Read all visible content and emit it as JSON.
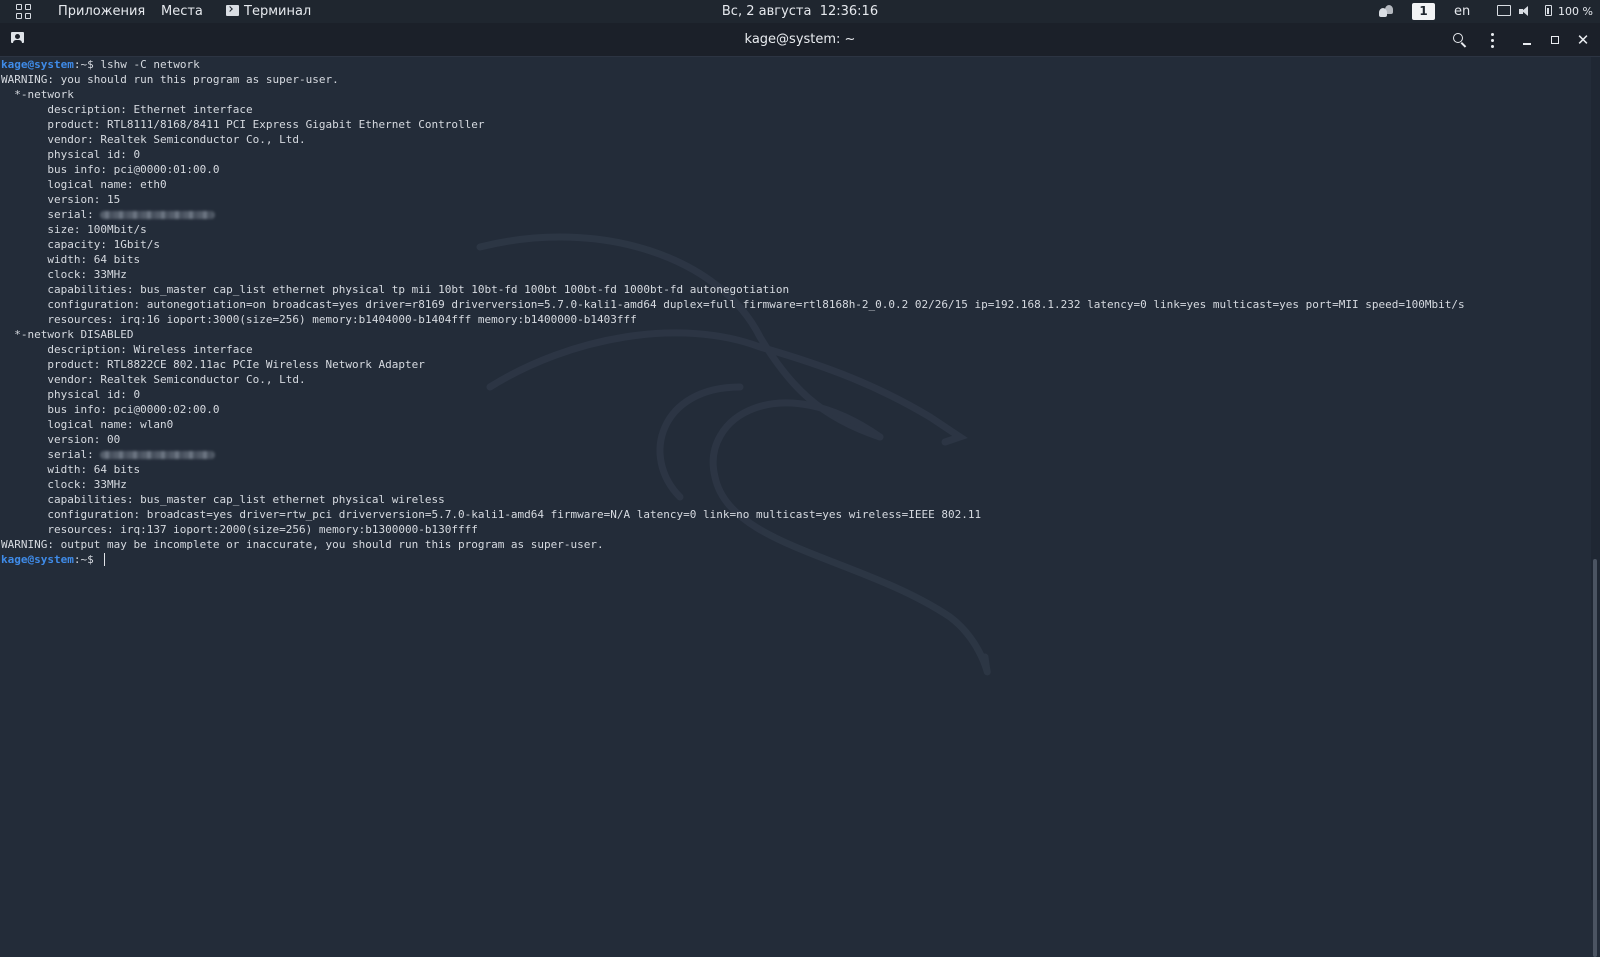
{
  "topbar": {
    "applications_label": "Приложения",
    "places_label": "Места",
    "terminal_label": "Терминал",
    "datetime": "Вс, 2 августа  12:36:16",
    "workspace": "1",
    "keyboard_layout": "en",
    "battery": "100 %"
  },
  "window": {
    "title": "kage@system: ~"
  },
  "terminal": {
    "prompt_user": "kage@system",
    "prompt_suffix": ":~$ ",
    "command": "lshw -C network",
    "lines": [
      "WARNING: you should run this program as super-user.",
      "  *-network",
      "       description: Ethernet interface",
      "       product: RTL8111/8168/8411 PCI Express Gigabit Ethernet Controller",
      "       vendor: Realtek Semiconductor Co., Ltd.",
      "       physical id: 0",
      "       bus info: pci@0000:01:00.0",
      "       logical name: eth0",
      "       version: 15",
      "       serial: ",
      "       size: 100Mbit/s",
      "       capacity: 1Gbit/s",
      "       width: 64 bits",
      "       clock: 33MHz",
      "       capabilities: bus_master cap_list ethernet physical tp mii 10bt 10bt-fd 100bt 100bt-fd 1000bt-fd autonegotiation",
      "       configuration: autonegotiation=on broadcast=yes driver=r8169 driverversion=5.7.0-kali1-amd64 duplex=full firmware=rtl8168h-2_0.0.2 02/26/15 ip=192.168.1.232 latency=0 link=yes multicast=yes port=MII speed=100Mbit/s",
      "       resources: irq:16 ioport:3000(size=256) memory:b1404000-b1404fff memory:b1400000-b1403fff",
      "  *-network DISABLED",
      "       description: Wireless interface",
      "       product: RTL8822CE 802.11ac PCIe Wireless Network Adapter",
      "       vendor: Realtek Semiconductor Co., Ltd.",
      "       physical id: 0",
      "       bus info: pci@0000:02:00.0",
      "       logical name: wlan0",
      "       version: 00",
      "       serial: ",
      "       width: 64 bits",
      "       clock: 33MHz",
      "       capabilities: bus_master cap_list ethernet physical wireless",
      "       configuration: broadcast=yes driver=rtw_pci driverversion=5.7.0-kali1-amd64 firmware=N/A latency=0 link=no multicast=yes wireless=IEEE 802.11",
      "       resources: irq:137 ioport:2000(size=256) memory:b1300000-b130ffff",
      "WARNING: output may be incomplete or inaccurate, you should run this program as super-user."
    ]
  },
  "colors": {
    "background": "#232c39",
    "topbar": "#1f262f",
    "header": "#1b2029",
    "prompt_user": "#3f8be8",
    "text": "#d6dae0"
  },
  "icons": {
    "apps": "apps-grid-icon",
    "terminal": "terminal-icon",
    "tab": "new-tab-icon",
    "search": "search-icon",
    "menu": "kebab-menu-icon",
    "minimize": "minimize-icon",
    "maximize": "maximize-icon",
    "close": "close-icon",
    "people": "people-icon",
    "display": "display-icon",
    "volume": "volume-icon",
    "battery": "battery-icon"
  }
}
